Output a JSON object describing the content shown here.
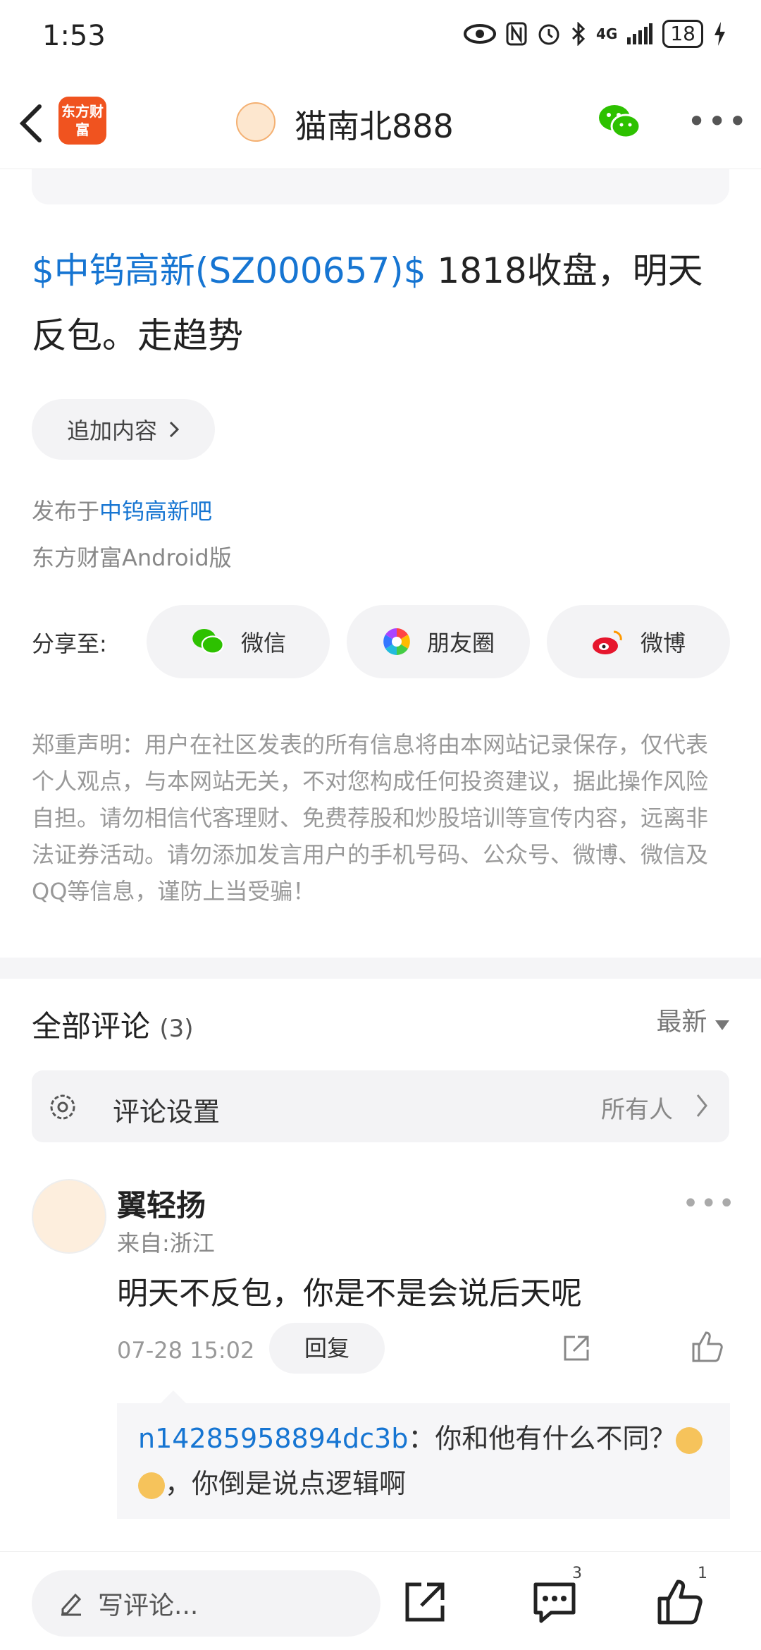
{
  "status_bar": {
    "time": "1:53",
    "network": "4G",
    "battery": "18"
  },
  "header": {
    "back_label": "back",
    "app_logo_text": "东方财富",
    "title": "猫南北888"
  },
  "post": {
    "stock_tag": "$中钨高新(SZ000657)$",
    "text": " 1818收盘，明天反包。走趋势",
    "add_content_label": "追加内容",
    "published_prefix": "发布于",
    "published_bar": "中钨高新吧",
    "client": "东方财富Android版"
  },
  "share": {
    "label": "分享至:",
    "buttons": [
      {
        "label": "微信",
        "icon": "wechat-icon"
      },
      {
        "label": "朋友圈",
        "icon": "moments-icon"
      },
      {
        "label": "微博",
        "icon": "weibo-icon"
      }
    ]
  },
  "disclaimer": "郑重声明：用户在社区发表的所有信息将由本网站记录保存，仅代表个人观点，与本网站无关，不对您构成任何投资建议，据此操作风险自担。请勿相信代客理财、免费荐股和炒股培训等宣传内容，远离非法证券活动。请勿添加发言用户的手机号码、公众号、微博、微信及QQ等信息，谨防上当受骗！",
  "comments": {
    "title": "全部评论",
    "count": "(3)",
    "sort_label": "最新",
    "settings_label": "评论设置",
    "settings_value": "所有人",
    "items": [
      {
        "name": "翼轻扬",
        "location": "来自:浙江",
        "text": "明天不反包，你是不是会说后天呢",
        "time": "07-28 15:02",
        "reply_label": "回复",
        "sub_reply": {
          "user": "n14285958894dc3b",
          "text_a": "：你和他有什么不同？",
          "text_b": "，你倒是说点逻辑啊"
        }
      }
    ]
  },
  "bottom_bar": {
    "write_placeholder": "写评论...",
    "comment_count": "3",
    "like_count": "1"
  },
  "colors": {
    "link": "#1675d2",
    "brand": "#f0531f",
    "wechat": "#2dc100"
  }
}
